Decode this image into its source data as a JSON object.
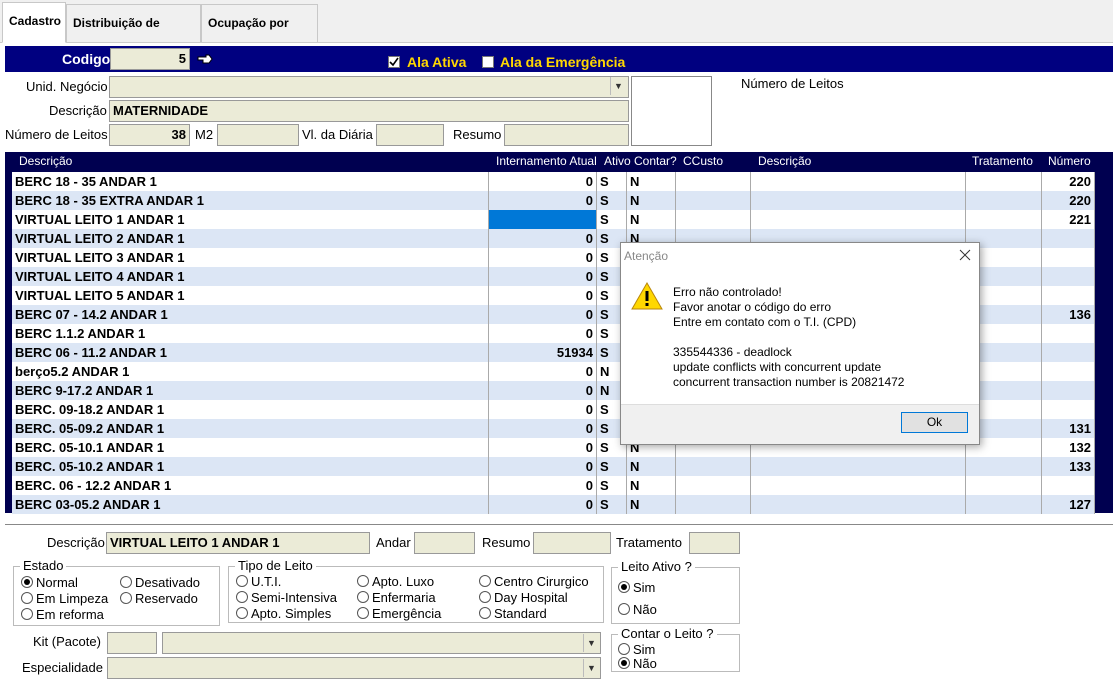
{
  "tabs": [
    "Cadastro",
    "Distribuição de Leitos",
    "Ocupação por leito"
  ],
  "header": {
    "codigo_label": "Codigo",
    "codigo_value": "5",
    "ala_ativa_label": "Ala Ativa",
    "ala_ativa_checked": true,
    "ala_emergencia_label": "Ala da Emergência",
    "ala_emergencia_checked": false
  },
  "form": {
    "unid_negocio_label": "Unid. Negócio",
    "unid_negocio_value": "",
    "descricao_label": "Descrição",
    "descricao_value": "MATERNIDADE",
    "num_leitos_label": "Número de Leitos",
    "num_leitos_value": "38",
    "m2_label": "M2",
    "m2_value": "",
    "vl_diaria_label": "Vl. da Diária",
    "vl_diaria_value": "",
    "resumo_label": "Resumo",
    "resumo_value": "",
    "num_leitos_right_label": "Número de Leitos"
  },
  "grid": {
    "headers": [
      "Descrição",
      "Internamento Atual",
      "Ativo",
      "Contar?",
      "CCusto",
      "Descrição",
      "Tratamento",
      "Número"
    ],
    "rows": [
      {
        "descricao": "BERC 18 - 35 ANDAR 1",
        "intern": "0",
        "ativo": "S",
        "contar": "N",
        "numero": "220"
      },
      {
        "descricao": "BERC 18 - 35 EXTRA ANDAR 1",
        "intern": "0",
        "ativo": "S",
        "contar": "N",
        "numero": "220"
      },
      {
        "descricao": "VIRTUAL LEITO 1 ANDAR 1",
        "intern": "",
        "ativo": "S",
        "contar": "N",
        "numero": "221"
      },
      {
        "descricao": "VIRTUAL LEITO 2 ANDAR 1",
        "intern": "0",
        "ativo": "S",
        "contar": "N",
        "numero": ""
      },
      {
        "descricao": "VIRTUAL LEITO 3 ANDAR 1",
        "intern": "0",
        "ativo": "S",
        "contar": "",
        "numero": ""
      },
      {
        "descricao": "VIRTUAL LEITO 4 ANDAR 1",
        "intern": "0",
        "ativo": "S",
        "contar": "",
        "numero": ""
      },
      {
        "descricao": "VIRTUAL LEITO 5 ANDAR 1",
        "intern": "0",
        "ativo": "S",
        "contar": "",
        "numero": ""
      },
      {
        "descricao": "BERC 07 - 14.2 ANDAR 1",
        "intern": "0",
        "ativo": "S",
        "contar": "",
        "numero": "136"
      },
      {
        "descricao": "BERC 1.1.2 ANDAR 1",
        "intern": "0",
        "ativo": "S",
        "contar": "",
        "numero": ""
      },
      {
        "descricao": "BERC 06 - 11.2 ANDAR 1",
        "intern": "51934",
        "ativo": "S",
        "contar": "",
        "numero": ""
      },
      {
        "descricao": "berço5.2 ANDAR 1",
        "intern": "0",
        "ativo": "N",
        "contar": "",
        "numero": ""
      },
      {
        "descricao": "BERC 9-17.2 ANDAR 1",
        "intern": "0",
        "ativo": "N",
        "contar": "",
        "numero": ""
      },
      {
        "descricao": "BERC. 09-18.2 ANDAR 1",
        "intern": "0",
        "ativo": "S",
        "contar": "",
        "numero": ""
      },
      {
        "descricao": "BERC. 05-09.2 ANDAR 1",
        "intern": "0",
        "ativo": "S",
        "contar": "",
        "numero": "131"
      },
      {
        "descricao": "BERC. 05-10.1 ANDAR 1",
        "intern": "0",
        "ativo": "S",
        "contar": "N",
        "numero": "132"
      },
      {
        "descricao": "BERC. 05-10.2 ANDAR 1",
        "intern": "0",
        "ativo": "S",
        "contar": "N",
        "numero": "133"
      },
      {
        "descricao": "BERC. 06 - 12.2 ANDAR 1",
        "intern": "0",
        "ativo": "S",
        "contar": "N",
        "numero": ""
      },
      {
        "descricao": "BERC 03-05.2 ANDAR 1",
        "intern": "0",
        "ativo": "S",
        "contar": "N",
        "numero": "127"
      }
    ]
  },
  "detail": {
    "descricao_label": "Descrição",
    "descricao_value": "VIRTUAL LEITO 1 ANDAR 1",
    "andar_label": "Andar",
    "andar_value": "",
    "resumo_label": "Resumo",
    "resumo_value": "",
    "tratamento_label": "Tratamento",
    "tratamento_value": "",
    "estado_title": "Estado",
    "estado_options": [
      "Normal",
      "Desativado",
      "Em Limpeza",
      "Reservado",
      "Em reforma"
    ],
    "tipo_title": "Tipo de Leito",
    "tipo_options": [
      "U.T.I.",
      "Apto. Luxo",
      "Centro Cirurgico",
      "Semi-Intensiva",
      "Enfermaria",
      "Day Hospital",
      "Apto. Simples",
      "Emergência",
      "Standard"
    ],
    "leito_ativo_title": "Leito Ativo ?",
    "leito_ativo_options": [
      "Sim",
      "Não"
    ],
    "contar_title": "Contar o Leito ?",
    "contar_options": [
      "Sim",
      "Não"
    ],
    "kit_label": "Kit (Pacote)",
    "especialidade_label": "Especialidade"
  },
  "dialog": {
    "title": "Atenção",
    "line1": "Erro não controlado!",
    "line2": "Favor anotar o código do erro",
    "line3": "Entre em contato com o T.I. (CPD)",
    "line4": "335544336 - deadlock",
    "line5": "update conflicts with concurrent update",
    "line6": "concurrent transaction number is 20821472",
    "ok_label": "Ok",
    "icon": "warning-icon"
  }
}
